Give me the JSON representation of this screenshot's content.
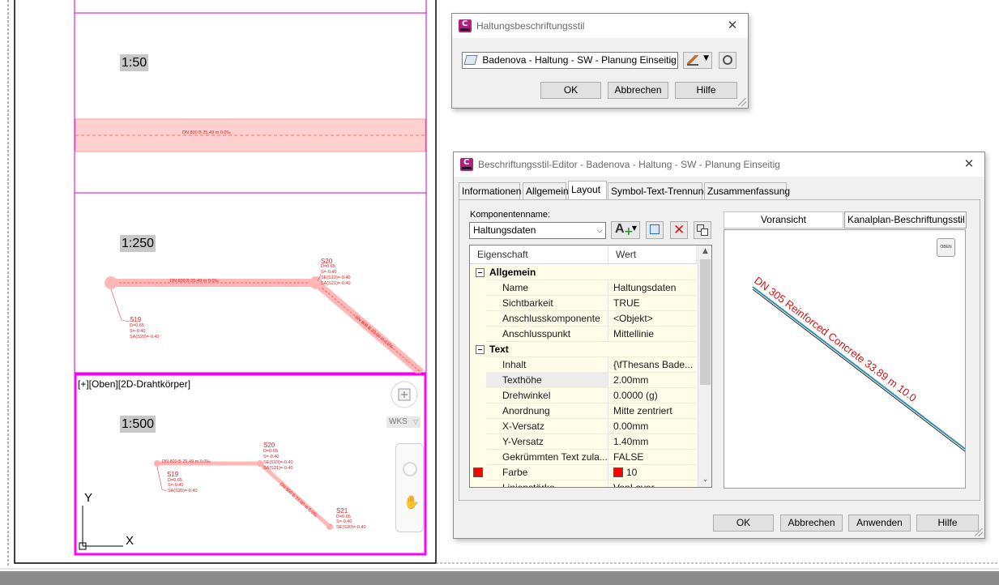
{
  "viewports": {
    "v1": {
      "scale": "1:50",
      "pipe_label": "DN 800   B     25.49  m      0.0‰"
    },
    "v2": {
      "scale": "1:250",
      "pipe_label": "DN 800   B     25.49  m      0.0‰",
      "pipe_label_2": "DN 800    B     23.60 m      0.0‰",
      "s20": {
        "name": "S20",
        "l1": "D=0.65",
        "l2": "S=-0.40",
        "l3": "SE(S19)=-0.40",
        "l4": "SA(S21)=-0.40"
      },
      "s19": {
        "name": "S19",
        "l1": "D=0.65",
        "l2": "S=-0.40",
        "l3": "SA(S20)=-0.40"
      }
    },
    "v3": {
      "label": "[+][Oben][2D-Drahtkörper]",
      "scale": "1:500",
      "wks": "WKS",
      "pipe_label": "DN 800   B     25.49  m      0.0‰",
      "pipe_label_2": "DN 800   B     23.60 m      0.0‰",
      "s19": {
        "name": "S19",
        "l1": "D=0.65",
        "l2": "S=-0.40",
        "l3": "SA(S20)=-0.40"
      },
      "s20": {
        "name": "S20",
        "l1": "D=0.65",
        "l2": "S=-0.40",
        "l3": "SE(S19)=-0.40",
        "l4": "SA(S21)=-0.40"
      },
      "s21": {
        "name": "S21",
        "l1": "D=0.65",
        "l2": "S=-0.40",
        "l3": "SE(S20)=-0.40"
      },
      "ucs": {
        "y": "Y",
        "x": "X"
      }
    }
  },
  "dialog1": {
    "title": "Haltungsbeschriftungsstil",
    "style_value": "Badenova - Haltung - SW - Planung Einseitig",
    "ok": "OK",
    "cancel": "Abbrechen",
    "help": "Hilfe"
  },
  "editor": {
    "title": "Beschriftungsstil-Editor - Badenova - Haltung - SW - Planung Einseitig",
    "tabs": [
      "Informationen",
      "Allgemein",
      "Layout",
      "Symbol-Text-Trennung",
      "Zusammenfassung"
    ],
    "active_tab": "Layout",
    "component_label": "Komponentenname:",
    "component_value": "Haltungsdaten",
    "grid_headers": {
      "property": "Eigenschaft",
      "value": "Wert"
    },
    "grid": {
      "cat_general": "Allgemein",
      "rows_general": [
        {
          "name": "Name",
          "value": "Haltungsdaten"
        },
        {
          "name": "Sichtbarkeit",
          "value": "TRUE"
        },
        {
          "name": "Anschlusskomponente",
          "value": "<Objekt>"
        },
        {
          "name": "Anschlusspunkt",
          "value": "Mittellinie"
        }
      ],
      "cat_text": "Text",
      "rows_text": [
        {
          "name": "Inhalt",
          "value": "{\\fThesans Bade..."
        },
        {
          "name": "Texthöhe",
          "value": "2.00mm"
        },
        {
          "name": "Drehwinkel",
          "value": "0.0000 (g)"
        },
        {
          "name": "Anordnung",
          "value": "Mitte zentriert"
        },
        {
          "name": "X-Versatz",
          "value": "0.00mm"
        },
        {
          "name": "Y-Versatz",
          "value": "1.40mm"
        },
        {
          "name": "Gekrümmten Text zula...",
          "value": "FALSE"
        },
        {
          "name": "Farbe",
          "value": "10"
        },
        {
          "name": "Linienstärke",
          "value": "VonLayer"
        }
      ]
    },
    "preview_label": "Voransicht",
    "preview_style": "Kanalplan-Beschriftungsstil",
    "preview_toggle": "OBEN",
    "preview_text": "DN 305  Reinforced Concrete    33.89 m    10.0",
    "color_red": "#ff0000",
    "ok": "OK",
    "cancel": "Abbrechen",
    "apply": "Anwenden",
    "help": "Hilfe"
  }
}
